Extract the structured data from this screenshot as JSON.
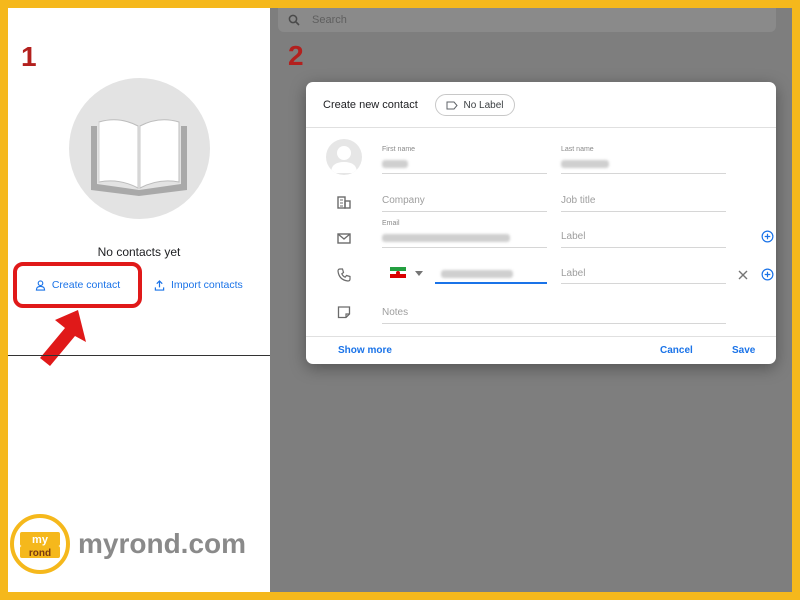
{
  "steps": {
    "left": "1",
    "right": "2"
  },
  "left_panel": {
    "empty_text": "No contacts yet",
    "create_label": "Create contact",
    "import_label": "Import contacts"
  },
  "watermark": {
    "text": "myrond.com",
    "logo_top": "my",
    "logo_bottom": "rond"
  },
  "search": {
    "placeholder": "Search"
  },
  "dialog": {
    "title": "Create new contact",
    "label_chip": "No Label",
    "first_name_label": "First name",
    "last_name_label": "Last name",
    "company_placeholder": "Company",
    "job_title_placeholder": "Job title",
    "email_label": "Email",
    "label_placeholder": "Label",
    "notes_placeholder": "Notes",
    "show_more": "Show more",
    "cancel": "Cancel",
    "save": "Save"
  },
  "colors": {
    "frame": "#f5b81c",
    "highlight": "#e01919",
    "accent": "#1a73e8",
    "step_number": "#b3201e",
    "flag": [
      "#239f40",
      "#ffffff",
      "#da0000"
    ]
  }
}
